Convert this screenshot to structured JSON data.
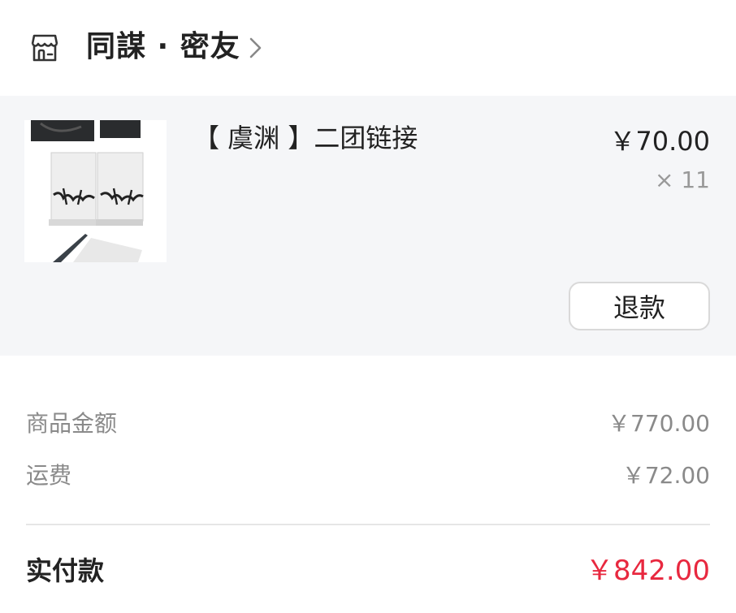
{
  "shop": {
    "name": "同謀 · 密友",
    "icon": "storefront-icon",
    "chevron_icon": "chevron-right-icon"
  },
  "product": {
    "title": "【 虞渊 】二团链接",
    "price": "￥70.00",
    "quantity": "× 11",
    "thumbnail_label": "product-photo",
    "refund_label": "退款"
  },
  "summary": {
    "goods_label": "商品金额",
    "goods_value": "￥770.00",
    "shipping_label": "运费",
    "shipping_value": "￥72.00"
  },
  "total": {
    "label": "实付款",
    "value": "￥842.00"
  },
  "colors": {
    "accent_red": "#e8283f",
    "section_bg": "#f5f6f8",
    "text_primary": "#222222",
    "text_secondary": "#8a8a8a"
  }
}
